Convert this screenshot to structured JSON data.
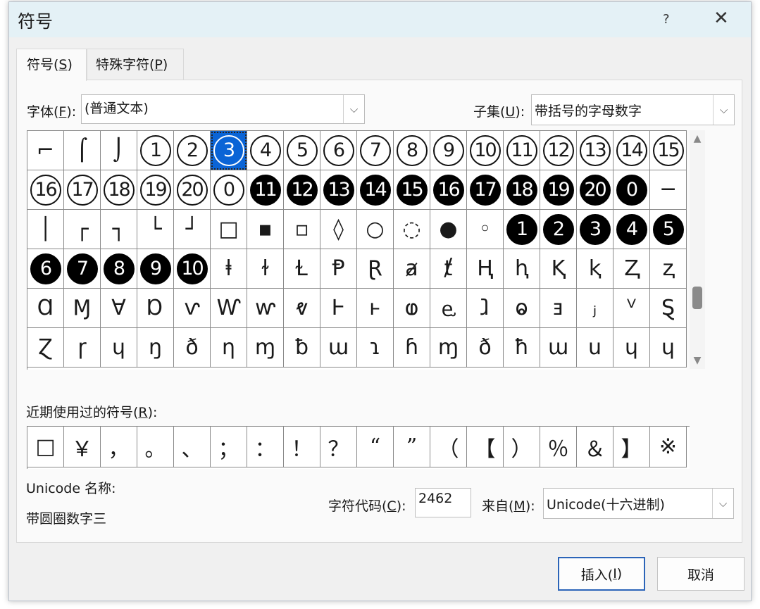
{
  "dialog": {
    "title": "符号",
    "help_icon": "?",
    "close_icon": "✕"
  },
  "tabs": [
    {
      "text": "符号(",
      "key": "S",
      "end": ")"
    },
    {
      "text": "特殊字符(",
      "key": "P",
      "end": ")"
    }
  ],
  "font": {
    "label_text": "字体(",
    "label_key": "F",
    "label_end": "):",
    "value": "(普通文本)"
  },
  "subset": {
    "label_text": "子集(",
    "label_key": "U",
    "label_end": "):",
    "value": "带括号的字母数字"
  },
  "symbol_grid": [
    [
      {
        "c": "⌐"
      },
      {
        "c": "⌠"
      },
      {
        "c": "⌡"
      },
      {
        "c": "1",
        "k": "o"
      },
      {
        "c": "2",
        "k": "o"
      },
      {
        "c": "3",
        "k": "o"
      },
      {
        "c": "4",
        "k": "o"
      },
      {
        "c": "5",
        "k": "o"
      },
      {
        "c": "6",
        "k": "o"
      },
      {
        "c": "7",
        "k": "o"
      },
      {
        "c": "8",
        "k": "o"
      },
      {
        "c": "9",
        "k": "o"
      },
      {
        "c": "10",
        "k": "o"
      },
      {
        "c": "11",
        "k": "o"
      },
      {
        "c": "12",
        "k": "o"
      },
      {
        "c": "13",
        "k": "o"
      },
      {
        "c": "14",
        "k": "o"
      },
      {
        "c": "15",
        "k": "o"
      }
    ],
    [
      {
        "c": "16",
        "k": "o"
      },
      {
        "c": "17",
        "k": "o"
      },
      {
        "c": "18",
        "k": "o"
      },
      {
        "c": "19",
        "k": "o"
      },
      {
        "c": "20",
        "k": "o"
      },
      {
        "c": "0",
        "k": "o"
      },
      {
        "c": "11",
        "k": "n"
      },
      {
        "c": "12",
        "k": "n"
      },
      {
        "c": "13",
        "k": "n"
      },
      {
        "c": "14",
        "k": "n"
      },
      {
        "c": "15",
        "k": "n"
      },
      {
        "c": "16",
        "k": "n"
      },
      {
        "c": "17",
        "k": "n"
      },
      {
        "c": "18",
        "k": "n"
      },
      {
        "c": "19",
        "k": "n"
      },
      {
        "c": "20",
        "k": "n"
      },
      {
        "c": "0",
        "k": "n"
      },
      {
        "c": "─"
      }
    ],
    [
      {
        "c": "│"
      },
      {
        "c": "┌"
      },
      {
        "c": "┐"
      },
      {
        "c": "└"
      },
      {
        "c": "┘"
      },
      {
        "c": "□"
      },
      {
        "c": "▪"
      },
      {
        "c": "▫"
      },
      {
        "c": "◊"
      },
      {
        "c": "○"
      },
      {
        "c": "◌"
      },
      {
        "c": "●"
      },
      {
        "c": "◦"
      },
      {
        "c": "1",
        "k": "n"
      },
      {
        "c": "2",
        "k": "n"
      },
      {
        "c": "3",
        "k": "n"
      },
      {
        "c": "4",
        "k": "n"
      },
      {
        "c": "5",
        "k": "n"
      }
    ],
    [
      {
        "c": "6",
        "k": "n"
      },
      {
        "c": "7",
        "k": "n"
      },
      {
        "c": "8",
        "k": "n"
      },
      {
        "c": "9",
        "k": "n"
      },
      {
        "c": "10",
        "k": "n"
      },
      {
        "c": "ⱡ"
      },
      {
        "c": "ɫ"
      },
      {
        "c": "Ɫ"
      },
      {
        "c": "Ᵽ"
      },
      {
        "c": "Ɽ"
      },
      {
        "c": "ⱥ"
      },
      {
        "c": "ⱦ"
      },
      {
        "c": "Ⱨ"
      },
      {
        "c": "ⱨ"
      },
      {
        "c": "Ⱪ"
      },
      {
        "c": "ⱪ"
      },
      {
        "c": "Ⱬ"
      },
      {
        "c": "ⱬ"
      }
    ],
    [
      {
        "c": "Ɑ"
      },
      {
        "c": "Ɱ"
      },
      {
        "c": "Ɐ"
      },
      {
        "c": "Ɒ"
      },
      {
        "c": "ⱱ"
      },
      {
        "c": "Ⱳ"
      },
      {
        "c": "ⱳ"
      },
      {
        "c": "ⱴ"
      },
      {
        "c": "Ⱶ"
      },
      {
        "c": "ⱶ"
      },
      {
        "c": "ⱷ"
      },
      {
        "c": "ⱸ"
      },
      {
        "c": "ⱹ"
      },
      {
        "c": "ⱺ"
      },
      {
        "c": "ⱻ"
      },
      {
        "c": "ⱼ"
      },
      {
        "c": "ⱽ"
      },
      {
        "c": "Ȿ"
      }
    ],
    [
      {
        "c": "Ɀ"
      },
      {
        "c": "ɼ"
      },
      {
        "c": "ɥ"
      },
      {
        "c": "ŋ"
      },
      {
        "c": "ð"
      },
      {
        "c": "η"
      },
      {
        "c": "ɱ"
      },
      {
        "c": "ƀ"
      },
      {
        "c": "ɯ"
      },
      {
        "c": "ɿ"
      },
      {
        "c": "ɦ"
      },
      {
        "c": "ɱ"
      },
      {
        "c": "ð"
      },
      {
        "c": "ħ"
      },
      {
        "c": "ɯ"
      },
      {
        "c": "u"
      },
      {
        "c": "ɥ"
      },
      {
        "c": "ɥ"
      }
    ]
  ],
  "selected": {
    "row": 0,
    "col": 5
  },
  "recent": {
    "label_text": "近期使用过的符号(",
    "label_key": "R",
    "label_end": "):",
    "symbols": [
      "□",
      "￥",
      "，",
      "。",
      "、",
      "；",
      "：",
      "！",
      "？",
      "“",
      "”",
      "（",
      "【",
      "）",
      "％",
      "＆",
      "】",
      "※"
    ]
  },
  "unicode": {
    "name_label": "Unicode 名称:",
    "name_value": "带圆圈数字三"
  },
  "char_code": {
    "label_text": "字符代码(",
    "label_key": "C",
    "label_end": "):",
    "value": "2462"
  },
  "from": {
    "label_text": "来自(",
    "label_key": "M",
    "label_end": "):",
    "value": "Unicode(十六进制)"
  },
  "buttons": {
    "insert_text": "插入(",
    "insert_key": "I",
    "insert_end": ")",
    "cancel": "取消"
  },
  "icons": {
    "dropdown": "⌵",
    "scroll_up": "▲",
    "scroll_down": "▼"
  }
}
